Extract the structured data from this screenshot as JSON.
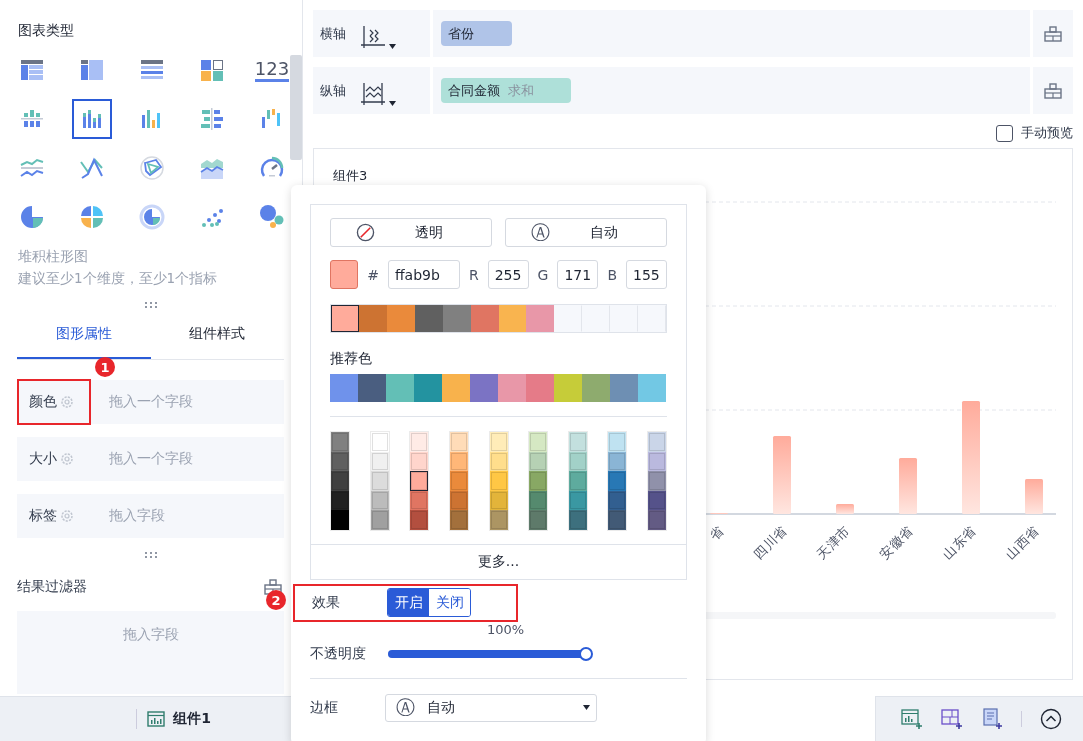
{
  "left_panel": {
    "chart_type_title": "图表类型",
    "chart_types": [
      {
        "selected": false
      },
      {
        "selected": false
      },
      {
        "selected": false
      },
      {
        "selected": false
      },
      {
        "selected": false,
        "text": "123"
      },
      {
        "selected": false
      },
      {
        "selected": true
      },
      {
        "selected": false
      },
      {
        "selected": false
      },
      {
        "selected": false
      },
      {
        "selected": false
      },
      {
        "selected": false
      },
      {
        "selected": false
      },
      {
        "selected": false
      },
      {
        "selected": false
      },
      {
        "selected": false
      },
      {
        "selected": false
      },
      {
        "selected": false
      },
      {
        "selected": false
      },
      {
        "selected": false
      }
    ],
    "chart_name": "堆积柱形图",
    "chart_hint": "建议至少1个维度，至少1个指标",
    "tabs": [
      {
        "label": "图形属性",
        "selected": true
      },
      {
        "label": "组件样式",
        "selected": false
      }
    ],
    "properties": [
      {
        "label": "颜色",
        "placeholder": "拖入一个字段",
        "highlighted": true
      },
      {
        "label": "大小",
        "placeholder": "拖入一个字段",
        "highlighted": false
      },
      {
        "label": "标签",
        "placeholder": "拖入字段",
        "highlighted": false
      }
    ],
    "filter": {
      "title": "结果过滤器",
      "placeholder": "拖入字段"
    },
    "component_tab": "组件1"
  },
  "axes": [
    {
      "label": "横轴",
      "fields": [
        {
          "name": "省份",
          "kind": "dimension"
        }
      ]
    },
    {
      "label": "纵轴",
      "fields": [
        {
          "name": "合同金额",
          "aggregation": "求和",
          "kind": "measure"
        }
      ]
    }
  ],
  "manual_preview": {
    "label": "手动预览",
    "checked": false
  },
  "chart": {
    "title": "组件3",
    "categories": [
      "省",
      "四川省",
      "天津市",
      "安徽省",
      "山东省",
      "山西省"
    ]
  },
  "color_popup": {
    "buttons": [
      {
        "kind": "transparent",
        "label": "透明"
      },
      {
        "kind": "auto",
        "icon": "Ⓐ",
        "label": "自动"
      }
    ],
    "current": {
      "color": "#ffab9b",
      "hash": "#",
      "hex": "ffab9b",
      "r_label": "R",
      "r": "255",
      "g_label": "G",
      "g": "171",
      "b_label": "B",
      "b": "155"
    },
    "recent": [
      {
        "kind": "color",
        "color": "#ffab9b",
        "selected": true
      },
      {
        "kind": "color",
        "color": "#cd7332",
        "selected": false
      },
      {
        "kind": "color",
        "color": "#ea8a3b",
        "selected": false
      },
      {
        "kind": "color",
        "color": "#606060",
        "selected": false
      },
      {
        "kind": "color",
        "color": "#808080",
        "selected": false
      },
      {
        "kind": "color",
        "color": "#e07562",
        "selected": false
      },
      {
        "kind": "color",
        "color": "#f9b44f",
        "selected": false
      },
      {
        "kind": "color",
        "color": "#e897a8",
        "selected": false
      },
      {
        "kind": "empty"
      },
      {
        "kind": "empty"
      },
      {
        "kind": "empty"
      },
      {
        "kind": "empty"
      }
    ],
    "recommended_title": "推荐色",
    "recommended": [
      {
        "color": "#6f92eb"
      },
      {
        "color": "#4a5e80"
      },
      {
        "color": "#63bfb6"
      },
      {
        "color": "#2393a0"
      },
      {
        "color": "#f8b24c"
      },
      {
        "color": "#7b73c4"
      },
      {
        "color": "#e897a8"
      },
      {
        "color": "#e57b88"
      },
      {
        "color": "#c6cc39"
      },
      {
        "color": "#8eab6e"
      },
      {
        "color": "#6e8fb3"
      },
      {
        "color": "#72c8e4"
      }
    ],
    "palette": [
      [
        {
          "color": "#808080",
          "selected": false
        },
        {
          "color": "#606060",
          "selected": false
        },
        {
          "color": "#404040",
          "selected": false
        },
        {
          "color": "#202020",
          "selected": false
        },
        {
          "color": "#000000",
          "selected": false
        }
      ],
      [
        {
          "color": "#ffffff",
          "selected": false
        },
        {
          "color": "#f0f0f0",
          "selected": false
        },
        {
          "color": "#dcdcdc",
          "selected": false
        },
        {
          "color": "#bcbcbc",
          "selected": false
        },
        {
          "color": "#a0a0a0",
          "selected": false
        }
      ],
      [
        {
          "color": "#ffebe6",
          "selected": false
        },
        {
          "color": "#ffd5cc",
          "selected": false
        },
        {
          "color": "#ffab9b",
          "selected": true
        },
        {
          "color": "#e07562",
          "selected": false
        },
        {
          "color": "#b34f3f",
          "selected": false
        }
      ],
      [
        {
          "color": "#ffdcb8",
          "selected": false
        },
        {
          "color": "#ffb778",
          "selected": false
        },
        {
          "color": "#ea8a3b",
          "selected": false
        },
        {
          "color": "#cd7332",
          "selected": false
        },
        {
          "color": "#a3703c",
          "selected": false
        }
      ],
      [
        {
          "color": "#ffecb8",
          "selected": false
        },
        {
          "color": "#ffde8c",
          "selected": false
        },
        {
          "color": "#ffc745",
          "selected": false
        },
        {
          "color": "#e3b43a",
          "selected": false
        },
        {
          "color": "#ac9563",
          "selected": false
        }
      ],
      [
        {
          "color": "#d5e8c3",
          "selected": false
        },
        {
          "color": "#b6d1b4",
          "selected": false
        },
        {
          "color": "#88a864",
          "selected": false
        },
        {
          "color": "#558a6e",
          "selected": false
        },
        {
          "color": "#5e7a6a",
          "selected": false
        }
      ],
      [
        {
          "color": "#c3e0de",
          "selected": false
        },
        {
          "color": "#a2d1c8",
          "selected": false
        },
        {
          "color": "#5eab9e",
          "selected": false
        },
        {
          "color": "#3a98a2",
          "selected": false
        },
        {
          "color": "#3d707e",
          "selected": false
        }
      ],
      [
        {
          "color": "#bfe2f1",
          "selected": false
        },
        {
          "color": "#8ab5d5",
          "selected": false
        },
        {
          "color": "#2878b5",
          "selected": false
        },
        {
          "color": "#325f90",
          "selected": false
        },
        {
          "color": "#425a76",
          "selected": false
        }
      ],
      [
        {
          "color": "#cad5e8",
          "selected": false
        },
        {
          "color": "#bab9de",
          "selected": false
        },
        {
          "color": "#9091aa",
          "selected": false
        },
        {
          "color": "#55528a",
          "selected": false
        },
        {
          "color": "#635b84",
          "selected": false
        }
      ]
    ],
    "more": "更多...",
    "effect": {
      "label": "效果",
      "highlighted": true,
      "options": [
        {
          "label": "开启",
          "selected": true
        },
        {
          "label": "关闭",
          "selected": false
        }
      ]
    },
    "opacity": {
      "label": "不透明度",
      "reading": "100%",
      "level": 1
    },
    "border": {
      "label": "边框",
      "icon": "Ⓐ",
      "value": "自动"
    }
  },
  "annotations": [
    {
      "number": "1"
    },
    {
      "number": "2"
    }
  ]
}
